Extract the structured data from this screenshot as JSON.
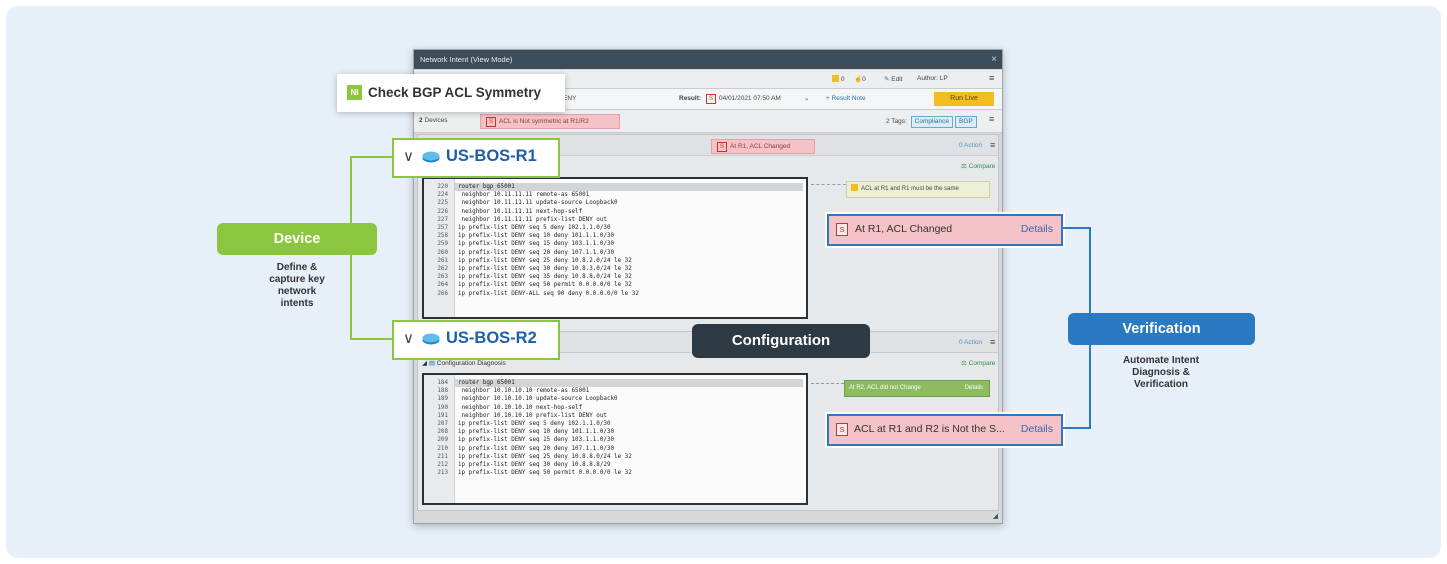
{
  "window": {
    "title": "Network Intent (View Mode)",
    "close": "×",
    "badge_count": "0",
    "like_count": "0",
    "edit_label": "Edit",
    "author": "Author: LP",
    "menu": "≡",
    "description_fragment": "tric ACL DENY",
    "result_label": "Result:",
    "result_sev": "S",
    "result_time": "04/01/2021 07:50 AM",
    "result_note": "+ Result Note",
    "run_live": "Run Live",
    "devices_count": "2",
    "devices_label": "Devices",
    "device_alert_sev": "S",
    "device_alert": "ACL is Not symmetric at R1/R2",
    "tags_label": "2 Tags:",
    "tags": [
      "Compliance",
      "BGP"
    ]
  },
  "intent_title_box": {
    "logo": "NI",
    "title": "Check BGP ACL Symmetry"
  },
  "device1": {
    "name": "US-BOS-R1",
    "header_alert_sev": "S",
    "header_alert": "At R1, ACL Changed",
    "action": "0 Action",
    "compare": "Compare",
    "note": "ACL at R1 and R1 must be the same",
    "lines": [
      {
        "n": "220",
        "t": "router bgp 65001"
      },
      {
        "n": "224",
        "t": " neighbor 10.11.11.11 remote-as 65001"
      },
      {
        "n": "225",
        "t": " neighbor 10.11.11.11 update-source Loopback0"
      },
      {
        "n": "226",
        "t": " neighbor 10.11.11.11 next-hop-self"
      },
      {
        "n": "227",
        "t": " neighbor 10.11.11.11 prefix-list DENY out"
      },
      {
        "n": "257",
        "t": "ip prefix-list DENY seq 5 deny 102.1.1.0/30"
      },
      {
        "n": "258",
        "t": "ip prefix-list DENY seq 10 deny 101.1.1.0/30"
      },
      {
        "n": "259",
        "t": "ip prefix-list DENY seq 15 deny 103.1.1.0/30"
      },
      {
        "n": "260",
        "t": "ip prefix-list DENY seq 20 deny 107.1.1.0/30"
      },
      {
        "n": "261",
        "t": "ip prefix-list DENY seq 25 deny 10.8.2.0/24 le 32"
      },
      {
        "n": "262",
        "t": "ip prefix-list DENY seq 30 deny 10.8.3.0/24 le 32"
      },
      {
        "n": "263",
        "t": "ip prefix-list DENY seq 35 deny 10.8.8.0/24 le 32"
      },
      {
        "n": "264",
        "t": "ip prefix-list DENY seq 50 permit 0.0.0.0/0 le 32"
      },
      {
        "n": "266",
        "t": "ip prefix-list DENY-ALL seq 90 deny 0.0.0.0/0 le 32"
      }
    ]
  },
  "device2": {
    "name": "US-BOS-R2",
    "action": "0 Action",
    "section_label": "Configuration Diagnosis",
    "compare": "Compare",
    "status": "At R2, ACL did not Change",
    "status_details": "Details",
    "lines": [
      {
        "n": "184",
        "t": "router bgp 65001"
      },
      {
        "n": "188",
        "t": " neighbor 10.10.10.10 remote-as 65001"
      },
      {
        "n": "189",
        "t": " neighbor 10.10.10.10 update-source Loopback0"
      },
      {
        "n": "190",
        "t": " neighbor 10.10.10.10 next-hop-self"
      },
      {
        "n": "191",
        "t": " neighbor 10.10.10.10 prefix-list DENY out"
      },
      {
        "n": "207",
        "t": "ip prefix-list DENY seq 5 deny 102.1.1.0/30"
      },
      {
        "n": "208",
        "t": "ip prefix-list DENY seq 10 deny 101.1.1.0/30"
      },
      {
        "n": "209",
        "t": "ip prefix-list DENY seq 15 deny 103.1.1.0/30"
      },
      {
        "n": "210",
        "t": "ip prefix-list DENY seq 20 deny 107.1.1.0/30"
      },
      {
        "n": "211",
        "t": "ip prefix-list DENY seq 25 deny 10.8.8.0/24 le 32"
      },
      {
        "n": "212",
        "t": "ip prefix-list DENY seq 30 deny 10.8.8.8/29"
      },
      {
        "n": "213",
        "t": "ip prefix-list DENY seq 50 permit 0.0.0.0/0 le 32"
      }
    ]
  },
  "callouts": {
    "c1_sev": "S",
    "c1_text": "At R1, ACL Changed",
    "c1_details": "Details",
    "c2_sev": "S",
    "c2_text": "ACL at R1 and R2 is Not the S...",
    "c2_details": "Details"
  },
  "annotations": {
    "device_title": "Device",
    "device_sub": [
      "Define &",
      "capture key",
      "network",
      "intents"
    ],
    "config_title": "Configuration",
    "verification_title": "Verification",
    "verification_sub": [
      "Automate Intent",
      "Diagnosis &",
      "Verification"
    ]
  },
  "colors": {
    "device_green": "#8cc63f",
    "verification_blue": "#2a7ac3",
    "config_dark": "#2d3a44",
    "severity_red": "#c0392b",
    "run_live_yellow": "#f3bd21"
  }
}
